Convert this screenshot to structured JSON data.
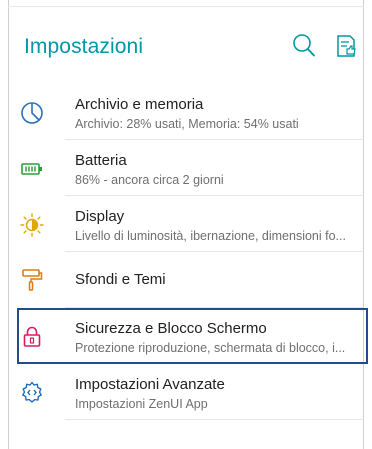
{
  "header": {
    "title": "Impostazioni",
    "icons": [
      "search-icon",
      "feedback-icon"
    ]
  },
  "colors": {
    "accent": "#0097a7",
    "storage_icon": "#2f6fb5",
    "battery_icon": "#2e9e3a",
    "display_icon": "#e0a800",
    "wallpaper_icon": "#e07a10",
    "security_icon": "#d81b60",
    "advanced_icon": "#1565c0",
    "highlight_border": "#1f4e8a"
  },
  "items": [
    {
      "label": "Archivio e memoria",
      "summary": "Archivio: 28% usati, Memoria: 54% usati",
      "icon": "storage-icon"
    },
    {
      "label": "Batteria",
      "summary": "86% - ancora circa 2 giorni",
      "icon": "battery-icon"
    },
    {
      "label": "Display",
      "summary": "Livello di luminosità, ibernazione, dimensioni fo...",
      "icon": "display-icon"
    },
    {
      "label": "Sfondi e Temi",
      "summary": "",
      "icon": "wallpaper-icon"
    },
    {
      "label": "Sicurezza e Blocco Schermo",
      "summary": "Protezione riproduzione, schermata di blocco, i...",
      "icon": "lock-icon"
    },
    {
      "label": "Impostazioni Avanzate",
      "summary": "Impostazioni ZenUI App",
      "icon": "advanced-settings-icon"
    }
  ]
}
